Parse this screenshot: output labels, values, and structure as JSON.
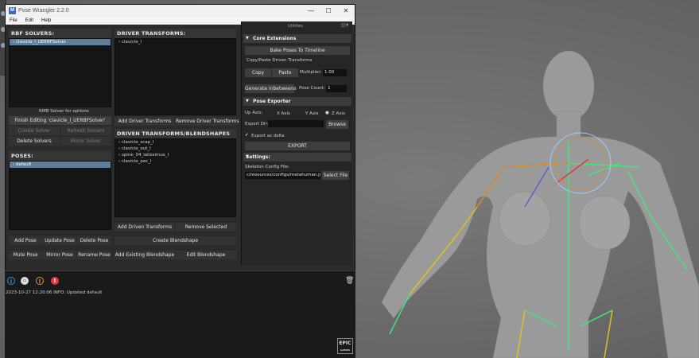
{
  "window": {
    "title": "Pose Wrangler 2.2.0",
    "controls": [
      "—",
      "☐",
      "✕"
    ],
    "menu": [
      "File",
      "Edit",
      "Help"
    ]
  },
  "rbf_solvers": {
    "header": "RBF SOLVERS:",
    "items": [
      "clavicle_l_UERBFSolver"
    ],
    "hint": "RMB Solver for options",
    "finish_label": "Finish Editing 'clavicle_l_UERBFSolver'",
    "create_solver": "Create Solver",
    "refresh_solvers": "Refresh Solvers",
    "delete_solvers": "Delete Solvers",
    "mirror_solver": "Mirror Solver"
  },
  "poses": {
    "header": "POSES:",
    "items": [
      "default"
    ],
    "add_pose": "Add Pose",
    "update_pose": "Update Pose",
    "delete_pose": "Delete Pose",
    "mute_pose": "Mute Pose",
    "mirror_pose": "Mirror Pose",
    "rename_pose": "Rename Pose"
  },
  "driver_transforms": {
    "header": "DRIVER TRANSFORMS:",
    "items": [
      "clavicle_l"
    ],
    "add_label": "Add Driver Transforms",
    "remove_label": "Remove Driver Transforms"
  },
  "driven_transforms": {
    "header": "DRIVEN TRANSFORMS/BLENDSHAPES",
    "items": [
      "clavicle_scap_l",
      "clavicle_out_l",
      "spine_04_latissimus_l",
      "clavicle_pec_l"
    ],
    "add_label": "Add Driven Transforms",
    "remove_label": "Remove Selected",
    "create_blendshape": "Create Blendshape",
    "add_existing_blendshape": "Add Existing Blendshape",
    "edit_blendshape": "Edit Blendshape"
  },
  "utilities": {
    "title": "Utilities",
    "core": {
      "header": "Core Extensions",
      "bake_label": "Bake Poses To Timeline",
      "copy_paste_label": "Copy/Paste Driven Transforms",
      "copy": "Copy",
      "paste": "Paste",
      "multiplier_label": "Multiplier:",
      "multiplier_value": "1.00",
      "generate_inbetweens": "Generate Inbetweens",
      "pose_count_label": "Pose Count:",
      "pose_count_value": "1"
    },
    "exporter": {
      "header": "Pose Exporter",
      "up_axis_label": "Up Axis:",
      "axes": [
        "X Axis",
        "Y Axis",
        "Z Axis"
      ],
      "export_dir_label": "Export Dir:",
      "export_dir_value": "",
      "browse": "Browse",
      "export_delta": "Export as delta",
      "export": "EXPORT"
    },
    "settings": {
      "header": "Settings:",
      "config_label": "Skeleton Config File:",
      "config_value": "c/resources/configs/metahuman.json",
      "select_file": "Select File"
    }
  },
  "console": {
    "log": "2023-10-27 12:20:06 INFO: Updated default",
    "logo_top": "EPIC",
    "logo_bottom": "GAMES"
  },
  "colors": {
    "selection": "#5d7f9c",
    "info_icon": "#3d8fe0",
    "warning_icon": "#e0a020",
    "error_icon": "#e03a3a",
    "rig_green": "#3ee878",
    "rig_orange": "#e08a20"
  }
}
